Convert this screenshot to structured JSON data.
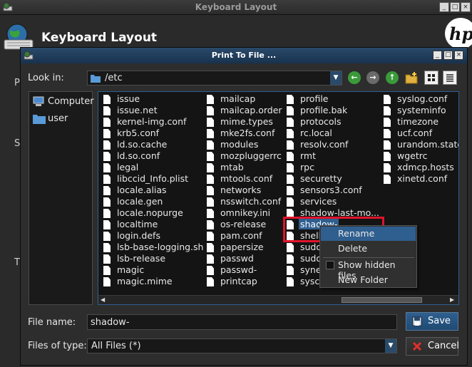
{
  "background_window": {
    "title": "Keyboard Layout",
    "header_title": "Keyboard Layout",
    "fragments": [
      "P",
      "S",
      "T"
    ]
  },
  "dialog": {
    "title": "Print To File ...",
    "look_in_label": "Look in:",
    "look_in_value": "/etc",
    "sidebar": [
      {
        "label": "Computer",
        "icon": "computer-icon"
      },
      {
        "label": "user",
        "icon": "folder-icon"
      }
    ],
    "files": {
      "col1": [
        "issue",
        "issue.net",
        "kernel-img.conf",
        "krb5.conf",
        "ld.so.cache",
        "ld.so.conf",
        "legal",
        "libccid_Info.plist",
        "locale.alias",
        "locale.gen",
        "locale.nopurge",
        "localtime",
        "login.defs",
        "lsb-base-logging.sh",
        "lsb-release",
        "magic",
        "magic.mime"
      ],
      "col2": [
        "mailcap",
        "mailcap.order",
        "mime.types",
        "mke2fs.conf",
        "modules",
        "mozpluggerrc",
        "mtab",
        "mtools.conf",
        "networks",
        "nsswitch.conf",
        "omnikey.ini",
        "os-release",
        "pam.conf",
        "papersize",
        "passwd",
        "passwd-",
        "printcap"
      ],
      "col3": [
        "profile",
        "profile.bak",
        "protocols",
        "rc.local",
        "resolv.conf",
        "rmt",
        "rpc",
        "securetty",
        "sensors3.conf",
        "services",
        "shadow-last-mo...",
        "shadow-",
        "shell",
        "sudo",
        "sudo",
        "syne",
        "sysc"
      ],
      "col4": [
        "syslog.conf",
        "systeminfo",
        "timezone",
        "ucf.conf",
        "urandom.state",
        "wgetrc",
        "xdmcp.hosts",
        "xinetd.conf"
      ]
    },
    "context_menu": {
      "rename": "Rename",
      "delete": "Delete",
      "show_hidden": "Show hidden files",
      "new_folder": "New Folder"
    },
    "file_name_label": "File name:",
    "file_name_value": "shadow-",
    "file_type_label": "Files of type:",
    "file_type_value": "All Files (*)",
    "save_label": "Save",
    "cancel_label": "Cancel"
  }
}
